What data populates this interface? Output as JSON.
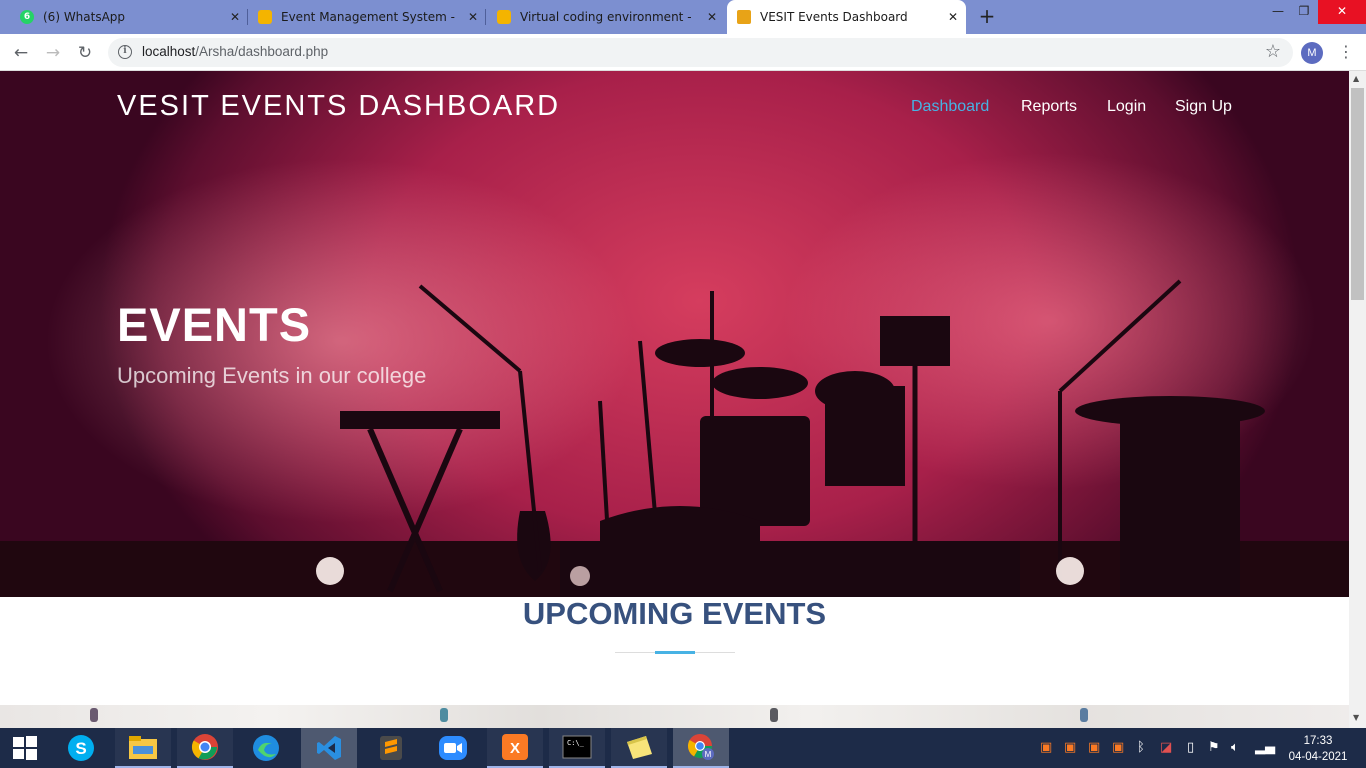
{
  "browser": {
    "tabs": [
      {
        "title": "(6) WhatsApp",
        "badge": "6",
        "icon": "whatsapp-icon",
        "favcolor": "#25d366"
      },
      {
        "title": "Event Management System - Goo",
        "icon": "google-slides-icon",
        "favcolor": "#f4b400"
      },
      {
        "title": "Virtual coding environment - Goo",
        "icon": "google-slides-icon",
        "favcolor": "#f4b400"
      },
      {
        "title": "VESIT Events Dashboard",
        "icon": "vesit-logo-icon",
        "favcolor": "#e8a317"
      }
    ],
    "url_host": "localhost",
    "url_path": "/Arsha/dashboard.php",
    "profile_initial": "M"
  },
  "page": {
    "brand": "VESIT EVENTS DASHBOARD",
    "nav": [
      "Dashboard",
      "Reports",
      "Login",
      "Sign Up"
    ],
    "active_nav": "Dashboard",
    "hero_title": "EVENTS",
    "hero_subtitle": "Upcoming Events in our college",
    "section_title": "UPCOMING EVENTS",
    "accent_color": "#47b2e4",
    "heading_color": "#37517e"
  },
  "taskbar": {
    "apps": [
      "windows-start-icon",
      "skype-icon",
      "file-explorer-icon",
      "chrome-icon",
      "edge-icon",
      "vscode-icon",
      "sublime-text-icon",
      "zoom-icon",
      "xampp-icon",
      "command-prompt-icon",
      "sticky-notes-icon",
      "chrome-profile-icon"
    ],
    "time": "17:33",
    "date": "04-04-2021"
  }
}
